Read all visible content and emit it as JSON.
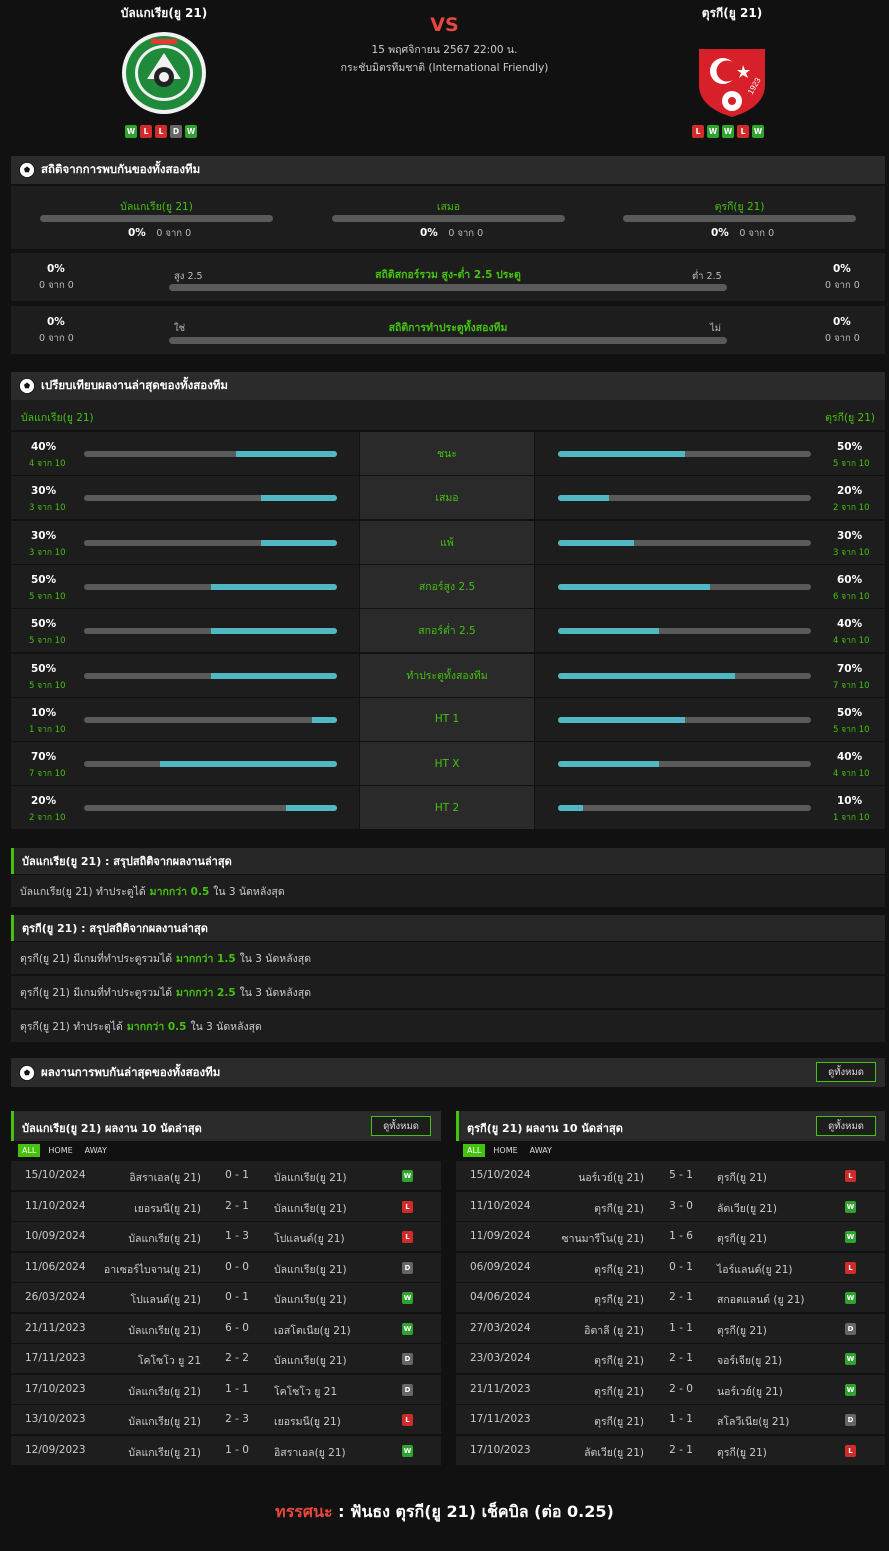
{
  "header": {
    "home": "บัลแกเรีย(ยู 21)",
    "away": "ตุรกี(ยู 21)",
    "vs": "VS",
    "date": "15 พฤศจิกายน 2567 22:00 น.",
    "competition": "กระชับมิตรทีมชาติ (International Friendly)",
    "home_form": [
      "W",
      "L",
      "L",
      "D",
      "W"
    ],
    "away_form": [
      "L",
      "W",
      "W",
      "L",
      "W"
    ],
    "home_logo_icon": "bulgaria-u21-crest",
    "away_logo_icon": "turkey-crest",
    "away_logo_year": "1923"
  },
  "h2h": {
    "title": "สถิติจากการพบกันของทั้งสองทีม",
    "home": "บัลแกเรีย(ยู 21)",
    "draw": "เสมอ",
    "away": "ตุรกี(ยู 21)",
    "home_pct": "0%",
    "draw_pct": "0%",
    "away_pct": "0%",
    "of": "0 จาก 0",
    "ou": {
      "left_pct": "0%",
      "left_of": "0 จาก 0",
      "over": "สูง 2.5",
      "title": "สถิติสกอร์รวม สูง-ต่ำ 2.5 ประตู",
      "under": "ต่ำ 2.5",
      "right_pct": "0%",
      "right_of": "0 จาก 0"
    },
    "btts": {
      "left_pct": "0%",
      "left_of": "0 จาก 0",
      "yes": "ใช่",
      "title": "สถิติการทำประตูทั้งสองทีม",
      "no": "ไม่",
      "right_pct": "0%",
      "right_of": "0 จาก 0"
    }
  },
  "compare": {
    "title": "เปรียบเทียบผลงานล่าสุดของทั้งสองทีม",
    "home": "บัลแกเรีย(ยู 21)",
    "away": "ตุรกี(ยู 21)",
    "rows": [
      {
        "label": "ชนะ",
        "hp": "40%",
        "hs": "4 จาก 10",
        "hv": 0.4,
        "ap": "50%",
        "as": "5 จาก 10",
        "av": 0.5
      },
      {
        "label": "เสมอ",
        "hp": "30%",
        "hs": "3 จาก 10",
        "hv": 0.3,
        "ap": "20%",
        "as": "2 จาก 10",
        "av": 0.2
      },
      {
        "label": "แพ้",
        "hp": "30%",
        "hs": "3 จาก 10",
        "hv": 0.3,
        "ap": "30%",
        "as": "3 จาก 10",
        "av": 0.3
      },
      {
        "label": "สกอร์สูง 2.5",
        "hp": "50%",
        "hs": "5 จาก 10",
        "hv": 0.5,
        "ap": "60%",
        "as": "6 จาก 10",
        "av": 0.6
      },
      {
        "label": "สกอร์ต่ำ 2.5",
        "hp": "50%",
        "hs": "5 จาก 10",
        "hv": 0.5,
        "ap": "40%",
        "as": "4 จาก 10",
        "av": 0.4
      },
      {
        "label": "ทำประตูทั้งสองทีม",
        "hp": "50%",
        "hs": "5 จาก 10",
        "hv": 0.5,
        "ap": "70%",
        "as": "7 จาก 10",
        "av": 0.7
      },
      {
        "label": "HT 1",
        "hp": "10%",
        "hs": "1 จาก 10",
        "hv": 0.1,
        "ap": "50%",
        "as": "5 จาก 10",
        "av": 0.5
      },
      {
        "label": "HT X",
        "hp": "70%",
        "hs": "7 จาก 10",
        "hv": 0.7,
        "ap": "40%",
        "as": "4 จาก 10",
        "av": 0.4
      },
      {
        "label": "HT 2",
        "hp": "20%",
        "hs": "2 จาก 10",
        "hv": 0.2,
        "ap": "10%",
        "as": "1 จาก 10",
        "av": 0.1
      }
    ]
  },
  "summary_home": {
    "title": "บัลแกเรีย(ยู 21) : สรุปสถิติจากผลงานล่าสุด",
    "rows": [
      {
        "a": "บัลแกเรีย(ยู 21)  ทำประตูได้",
        "b": "มากกว่า  0.5",
        "c": "ใน 3 นัดหลังสุด"
      }
    ]
  },
  "summary_away": {
    "title": "ตุรกี(ยู 21) : สรุปสถิติจากผลงานล่าสุด",
    "rows": [
      {
        "a": "ตุรกี(ยู 21)  มีเกมที่ทำประตูรวมได้",
        "b": "มากกว่า  1.5",
        "c": "ใน 3 นัดหลังสุด"
      },
      {
        "a": "ตุรกี(ยู 21)  มีเกมที่ทำประตูรวมได้",
        "b": "มากกว่า  2.5",
        "c": "ใน 3 นัดหลังสุด"
      },
      {
        "a": "ตุรกี(ยู 21)  ทำประตูได้",
        "b": "มากกว่า  0.5",
        "c": "ใน 3 นัดหลังสุด"
      }
    ]
  },
  "recent": {
    "title": "ผลงานการพบกันล่าสุดของทั้งสองทีม",
    "view_all": "ดูทั้งหมด"
  },
  "home_last10": {
    "title": "บัลแกเรีย(ยู 21) ผลงาน 10 นัดล่าสุด",
    "view_all": "ดูทั้งหมด",
    "tabs": [
      "ALL",
      "HOME",
      "AWAY"
    ],
    "matches": [
      [
        "15/10/2024",
        "อิสราเอล(ยู 21)",
        "0 - 1",
        "บัลแกเรีย(ยู 21)",
        "W"
      ],
      [
        "11/10/2024",
        "เยอรมนี(ยู 21)",
        "2 - 1",
        "บัลแกเรีย(ยู 21)",
        "L"
      ],
      [
        "10/09/2024",
        "บัลแกเรีย(ยู 21)",
        "1 - 3",
        "โปแลนด์(ยู 21)",
        "L"
      ],
      [
        "11/06/2024",
        "อาเซอร์ไบจาน(ยู 21)",
        "0 - 0",
        "บัลแกเรีย(ยู 21)",
        "D"
      ],
      [
        "26/03/2024",
        "โปแลนด์(ยู 21)",
        "0 - 1",
        "บัลแกเรีย(ยู 21)",
        "W"
      ],
      [
        "21/11/2023",
        "บัลแกเรีย(ยู 21)",
        "6 - 0",
        "เอสโตเนีย(ยู 21)",
        "W"
      ],
      [
        "17/11/2023",
        "โคโซโว ยู 21",
        "2 - 2",
        "บัลแกเรีย(ยู 21)",
        "D"
      ],
      [
        "17/10/2023",
        "บัลแกเรีย(ยู 21)",
        "1 - 1",
        "โคโซโว ยู 21",
        "D"
      ],
      [
        "13/10/2023",
        "บัลแกเรีย(ยู 21)",
        "2 - 3",
        "เยอรมนี(ยู 21)",
        "L"
      ],
      [
        "12/09/2023",
        "บัลแกเรีย(ยู 21)",
        "1 - 0",
        "อิสราเอล(ยู 21)",
        "W"
      ]
    ]
  },
  "away_last10": {
    "title": "ตุรกี(ยู 21) ผลงาน 10 นัดล่าสุด",
    "view_all": "ดูทั้งหมด",
    "tabs": [
      "ALL",
      "HOME",
      "AWAY"
    ],
    "matches": [
      [
        "15/10/2024",
        "นอร์เวย์(ยู 21)",
        "5 - 1",
        "ตุรกี(ยู 21)",
        "L"
      ],
      [
        "11/10/2024",
        "ตุรกี(ยู 21)",
        "3 - 0",
        "ลัตเวีย(ยู 21)",
        "W"
      ],
      [
        "11/09/2024",
        "ซานมารีโน(ยู 21)",
        "1 - 6",
        "ตุรกี(ยู 21)",
        "W"
      ],
      [
        "06/09/2024",
        "ตุรกี(ยู 21)",
        "0 - 1",
        "ไอร์แลนด์(ยู 21)",
        "L"
      ],
      [
        "04/06/2024",
        "ตุรกี(ยู 21)",
        "2 - 1",
        "สกอตแลนด์ (ยู 21)",
        "W"
      ],
      [
        "27/03/2024",
        "อิตาลี (ยู 21)",
        "1 - 1",
        "ตุรกี(ยู 21)",
        "D"
      ],
      [
        "23/03/2024",
        "ตุรกี(ยู 21)",
        "2 - 1",
        "จอร์เจีย(ยู 21)",
        "W"
      ],
      [
        "21/11/2023",
        "ตุรกี(ยู 21)",
        "2 - 0",
        "นอร์เวย์(ยู 21)",
        "W"
      ],
      [
        "17/11/2023",
        "ตุรกี(ยู 21)",
        "1 - 1",
        "สโลวีเนีย(ยู 21)",
        "D"
      ],
      [
        "17/10/2023",
        "ลัตเวีย(ยู 21)",
        "2 - 1",
        "ตุรกี(ยู 21)",
        "L"
      ]
    ]
  },
  "footer": {
    "label": "ทรรศนะ",
    "sep": " :  ",
    "text": "ฟันธง ตุรกี(ยู 21) เช็คบิล (ต่อ 0.25)"
  }
}
